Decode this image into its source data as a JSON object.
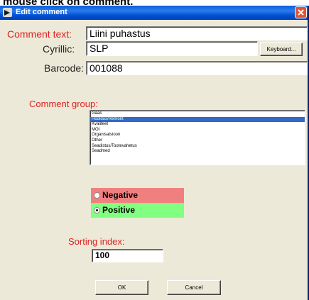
{
  "caption": "mouse click on comment.",
  "window": {
    "title": "Edit comment"
  },
  "form": {
    "comment_text_label": "Comment text:",
    "comment_text_value": "Liini puhastus",
    "cyrillic_label": "Cyrillic:",
    "cyrillic_value": "SLP",
    "keyboard_button": "Keyboard...",
    "barcode_label": "Barcode:",
    "barcode_value": "001088",
    "comment_group_label": "Comment group:",
    "comment_groups": [
      "Gaas",
      "Hooldus/Remont",
      "Kvaliteet",
      "MOI",
      "Organisatsioon",
      "Other",
      "Seadistus/Tootevahetus",
      "Seadmed"
    ],
    "selected_group": "Hooldus/Remont",
    "negative_label": "Negative",
    "positive_label": "Positive",
    "selected_polarity": "Positive",
    "sorting_index_label": "Sorting index:",
    "sorting_index_value": "100",
    "ok_button": "OK",
    "cancel_button": "Cancel"
  },
  "colors": {
    "label_red": "#e02020",
    "negative_bg": "#f08080",
    "positive_bg": "#80ff80",
    "selection": "#316ac5",
    "titlebar": "#0a5fd8"
  }
}
